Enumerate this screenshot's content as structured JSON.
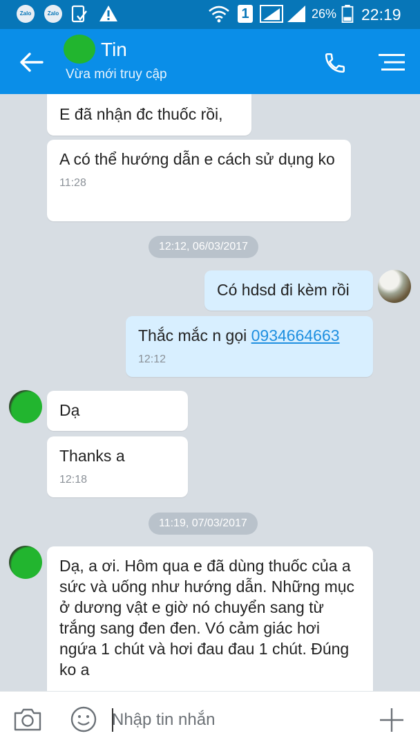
{
  "status_bar": {
    "app_badge_1": "Zalo",
    "app_badge_2": "Zalo",
    "sim_slot": "1",
    "battery": "26%",
    "time": "22:19"
  },
  "header": {
    "contact_name": "Tin",
    "presence": "Vừa mới truy cập"
  },
  "messages": {
    "m1": {
      "text": "E đã nhận đc thuốc rồi,"
    },
    "m2": {
      "text": "A có thể hướng dẫn e cách sử dụng ko",
      "time": "11:28"
    },
    "divider1": "12:12, 06/03/2017",
    "m3": {
      "text": "Có hdsd đi kèm rồi"
    },
    "m4": {
      "text_prefix": "Thắc mắc n gọi ",
      "phone": "0934664663",
      "time": "12:12"
    },
    "m5": {
      "text": "Dạ"
    },
    "m6": {
      "text": "Thanks a",
      "time": "12:18"
    },
    "divider2": "11:19, 07/03/2017",
    "m7": {
      "text": "Dạ, a ơi. Hôm qua e đã dùng thuốc của a sức và uống như hướng dẫn. Những mục ở dương vật e giờ nó chuyển sang từ trắng sang đen đen. Vó cảm giác hơi ngứa 1 chút và hơi đau đau 1 chút. Đúng ko a"
    }
  },
  "composer": {
    "placeholder": "Nhập tin nhắn"
  },
  "icons": {
    "back": "arrow-left-icon",
    "call": "phone-icon",
    "menu": "menu-icon",
    "camera": "camera-icon",
    "emoji": "emoji-icon",
    "add": "plus-icon"
  },
  "colors": {
    "status_bar": "#0776b8",
    "app_bar": "#0a8ee8",
    "chat_bg": "#d7dde3",
    "incoming_bubble": "#ffffff",
    "outgoing_bubble": "#d8efff",
    "link": "#1e8fe0",
    "avatar_mask": "#22b52f"
  }
}
